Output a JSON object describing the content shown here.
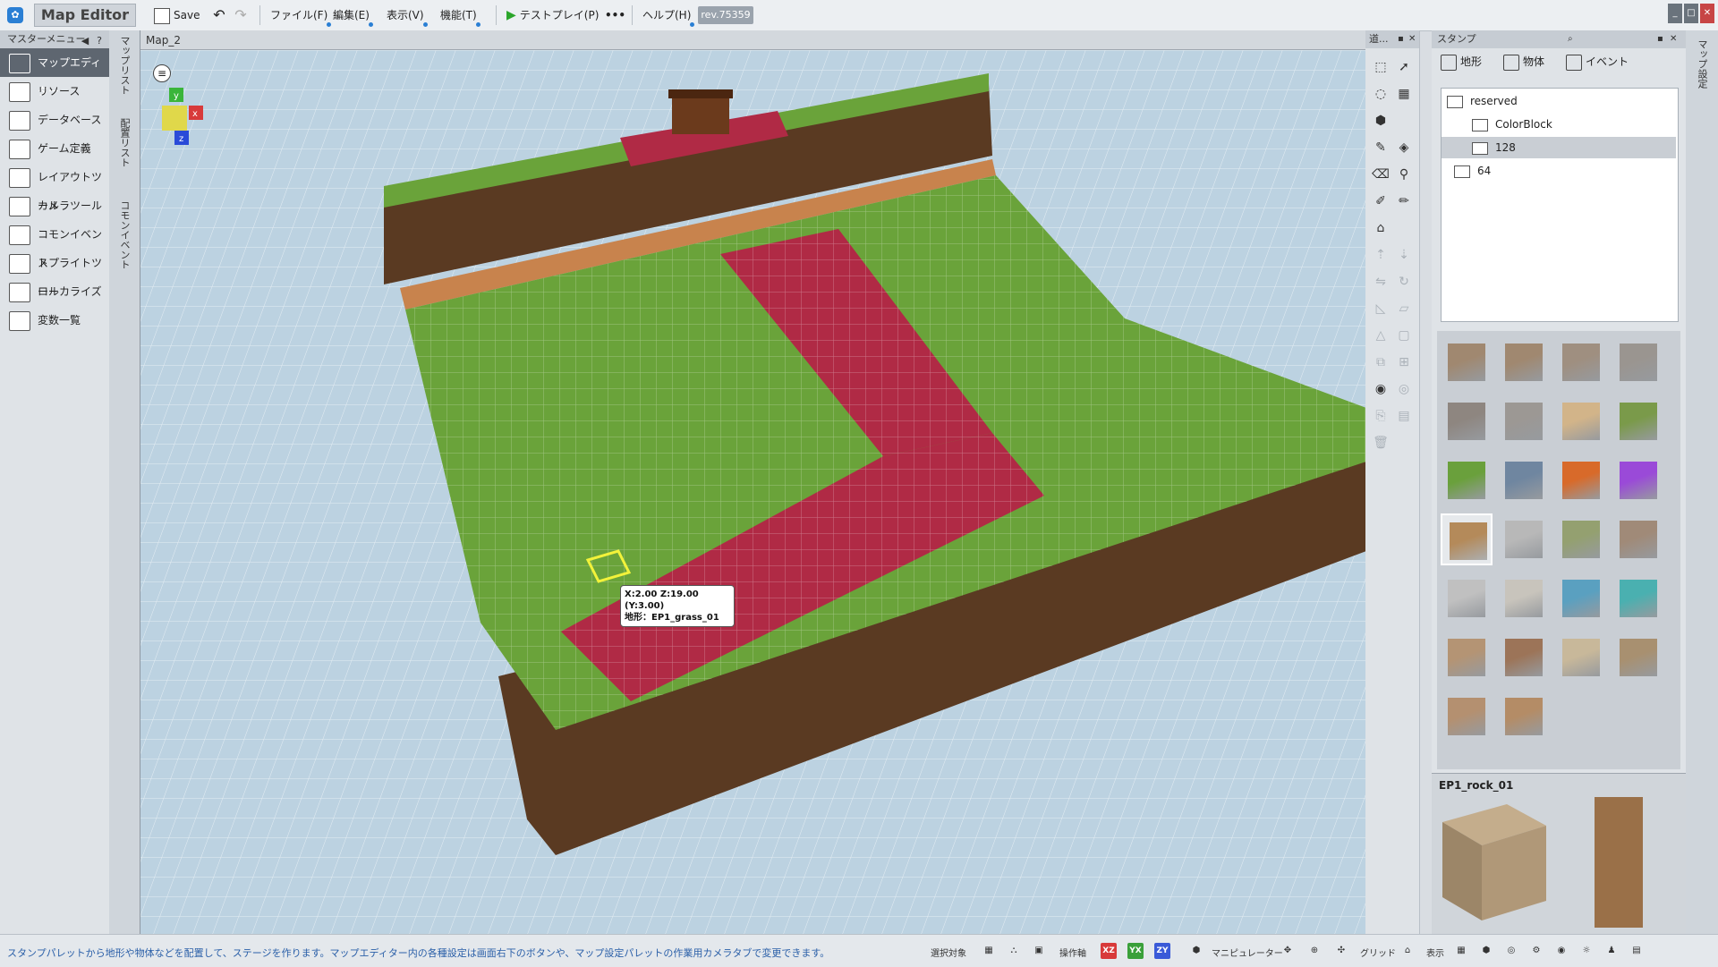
{
  "titlebar": {
    "app_title": "Map Editor",
    "save_label": "Save",
    "menus": [
      "ファイル(F)",
      "編集(E)",
      "表示(V)",
      "機能(T)"
    ],
    "testplay_label": "テストプレイ(P)",
    "more_label": "•••",
    "help_label": "ヘルプ(H)",
    "revision": "rev.75359"
  },
  "master_menu": {
    "title": "マスターメニュー",
    "items": [
      {
        "label": "マップエディター"
      },
      {
        "label": "リソース"
      },
      {
        "label": "データベース"
      },
      {
        "label": "ゲーム定義"
      },
      {
        "label": "レイアウトツール"
      },
      {
        "label": "カメラツール"
      },
      {
        "label": "コモンイベント"
      },
      {
        "label": "スプライトツール"
      },
      {
        "label": "ローカライズ"
      },
      {
        "label": "変数一覧"
      }
    ]
  },
  "side_strip": {
    "labels": [
      "マップリスト",
      "配置リスト",
      "コモンイベント"
    ]
  },
  "viewport": {
    "tab_label": "Map_2",
    "tooltip_line1": "X:2.00 Z:19.00 (Y:3.00)",
    "tooltip_line2": "地形：EP1_grass_01",
    "gizmo_labels": [
      "x",
      "y",
      "z"
    ]
  },
  "tools_panel": {
    "title": "道..."
  },
  "stamp_panel": {
    "title": "スタンプ",
    "tabs": [
      "地形",
      "物体",
      "イベント"
    ],
    "tree": [
      {
        "label": "reserved"
      },
      {
        "label": "ColorBlock"
      },
      {
        "label": "128"
      },
      {
        "label": "64"
      }
    ],
    "selected_tree_item": "128",
    "palette_colors": [
      "#a08870",
      "#a08870",
      "#9f8f80",
      "#9a9590",
      "#8e8680",
      "#9c9894",
      "#d2b489",
      "#7a9a4a",
      "#6aa03c",
      "#6f86a0",
      "#d86a2a",
      "#9a4ad8",
      "#b48a5a",
      "#b8b8b8",
      "#94a070",
      "#a08a78",
      "#c0c0c0",
      "#c8c4bc",
      "#5aa0c0",
      "#4ab0b0",
      "#b49474",
      "#9c7458",
      "#c8b89a",
      "#a89070",
      "#b49070",
      "#b48c66"
    ],
    "selected_index": 12,
    "preview_name": "EP1_rock_01"
  },
  "right_strip": {
    "label": "マップ設定"
  },
  "statusbar": {
    "message": "スタンプパレットから地形や物体などを配置して、ステージを作ります。マップエディター内の各種設定は画面右下のボタンや、マップ設定パレットの作業用カメラタブで変更できます。",
    "labels": [
      "選択対象",
      "操作軸",
      "マニピュレーター",
      "グリッド",
      "表示"
    ],
    "axis_buttons": [
      "XZ",
      "YX",
      "ZY"
    ]
  },
  "colors": {
    "grass": "#6aa33a",
    "road": "#b02a45",
    "dirt": "#5a3a22",
    "sky": "#bcd2e1"
  }
}
